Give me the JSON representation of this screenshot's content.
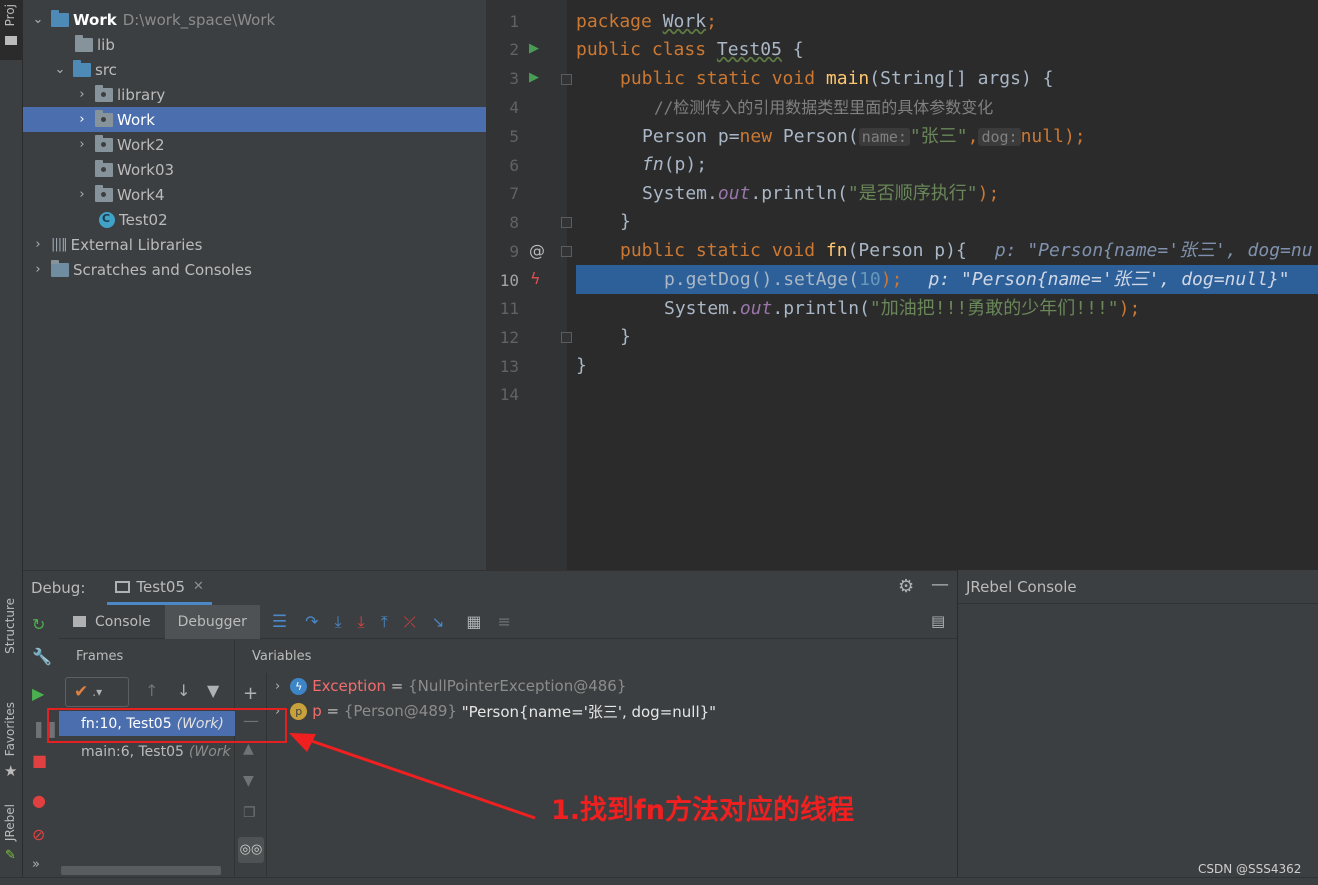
{
  "sidebar_tabs": {
    "project": "Proj",
    "structure": "Structure",
    "favorites": "Favorites",
    "jrebel": "JRebel"
  },
  "project_tree": [
    {
      "label": "Work",
      "path": "D:\\work_space\\Work",
      "expanded": true,
      "level": 0,
      "icon": "module-folder-icon"
    },
    {
      "label": "lib",
      "level": 1,
      "icon": "folder-icon"
    },
    {
      "label": "src",
      "level": 1,
      "expanded": true,
      "icon": "source-folder-icon"
    },
    {
      "label": "library",
      "level": 2,
      "icon": "package-icon"
    },
    {
      "label": "Work",
      "level": 2,
      "icon": "package-icon",
      "selected": true
    },
    {
      "label": "Work2",
      "level": 2,
      "icon": "package-icon"
    },
    {
      "label": "Work03",
      "level": 2,
      "icon": "package-icon"
    },
    {
      "label": "Work4",
      "level": 2,
      "icon": "package-icon"
    },
    {
      "label": "Test02",
      "level": 2,
      "icon": "class-icon"
    },
    {
      "label": "External Libraries",
      "level": 0,
      "icon": "library-icon"
    },
    {
      "label": "Scratches and Consoles",
      "level": 0,
      "icon": "scratches-icon"
    }
  ],
  "editor": {
    "line_numbers": [
      "1",
      "2",
      "3",
      "4",
      "5",
      "6",
      "7",
      "8",
      "9",
      "10",
      "11",
      "12",
      "13",
      "14"
    ],
    "current_line": "10",
    "lines": {
      "l1_kw": "package ",
      "l1_pkg": "Work",
      "l1_end": ";",
      "l2_kw": "public class ",
      "l2_name": "Test05",
      "l2_end": " {",
      "l3_kw": "public static void ",
      "l3_fn": "main",
      "l3_rest": "(String[] args) {",
      "l4": "//检测传入的引用数据类型里面的具体参数变化",
      "l5_a": "Person p=",
      "l5_kw": "new ",
      "l5_b": "Person(",
      "l5_h1": "name:",
      "l5_s": "\"张三\"",
      "l5_c": ",",
      "l5_h2": "dog:",
      "l5_kw2": "null",
      "l5_end": ");",
      "l6_fn": "fn",
      "l6_rest": "(p);",
      "l7_a": "System.",
      "l7_st": "out",
      "l7_b": ".println(",
      "l7_s": "\"是否顺序执行\"",
      "l7_end": ");",
      "l8": "}",
      "l9_kw": "public static void ",
      "l9_fn": "fn",
      "l9_rest": "(Person p){",
      "l9_inline": "p: \"Person{name='张三', dog=nu",
      "l10_a": "p.getDog().setAge(",
      "l10_num": "10",
      "l10_end": ");",
      "l10_inline": "p: \"Person{name='张三', dog=null}\"",
      "l11_a": "System.",
      "l11_st": "out",
      "l11_b": ".println(",
      "l11_s": "\"加油把!!!勇敢的少年们!!!\"",
      "l11_end": ");",
      "l12": "}",
      "l13": "}"
    }
  },
  "debug": {
    "label": "Debug:",
    "session_tab": "Test05",
    "subtabs": {
      "console": "Console",
      "debugger": "Debugger"
    },
    "frames_title": "Frames",
    "variables_title": "Variables",
    "frames": [
      {
        "method": "fn:10, Test05",
        "module": "(Work)",
        "selected": true
      },
      {
        "method": "main:6, Test05",
        "module": "(Work"
      }
    ],
    "variables": [
      {
        "name": "Exception",
        "eq": " = ",
        "ref": "{NullPointerException@486}",
        "value": ""
      },
      {
        "name": "p",
        "eq": " = ",
        "ref": "{Person@489}",
        "value": " \"Person{name='张三', dog=null}\""
      }
    ]
  },
  "jrebel_console": {
    "title": "JRebel Console"
  },
  "annotation": {
    "text": "1.找到fn方法对应的线程"
  },
  "watermark": "CSDN @SSS4362",
  "colors": {
    "selection": "#4b6eaf",
    "keyword": "#cc7832",
    "string": "#6a8759",
    "annotation": "#f02020"
  }
}
